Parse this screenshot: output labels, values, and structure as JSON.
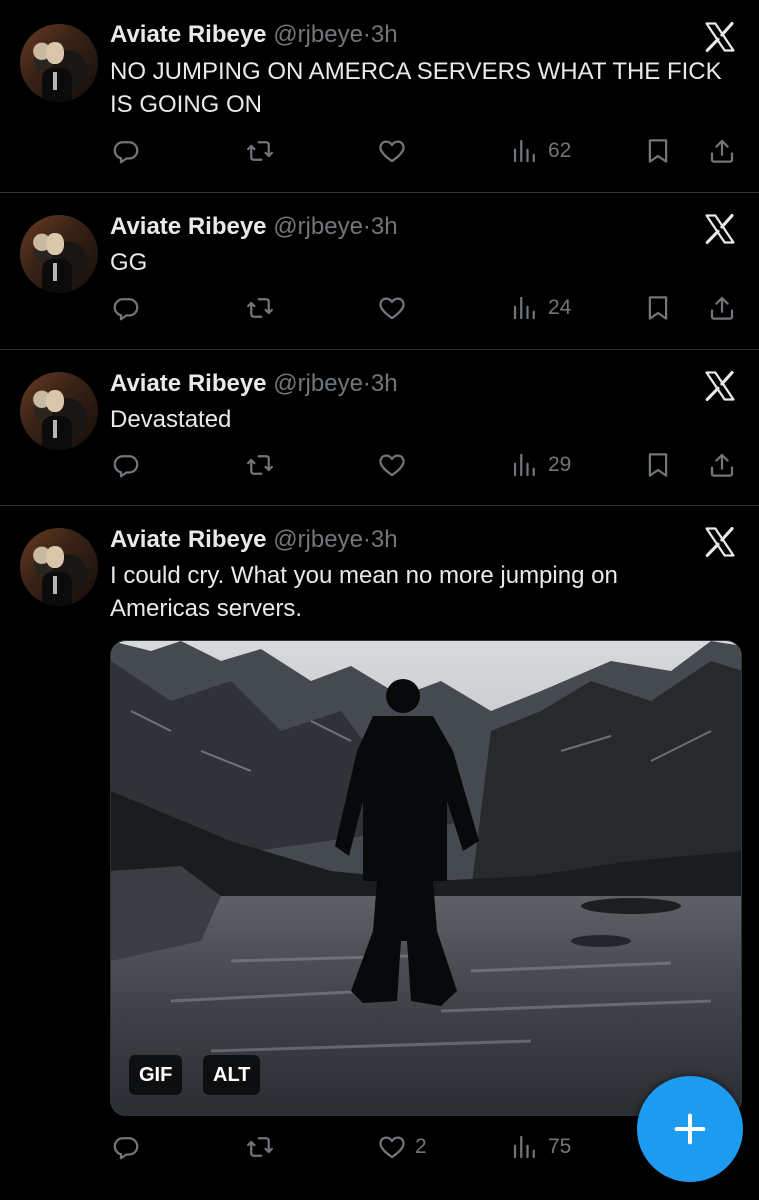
{
  "tweets": [
    {
      "name": "Aviate Ribeye",
      "handle": "@rjbeye",
      "separator": "·",
      "time": "3h",
      "text": "NO JUMPING ON AMERCA SERVERS WHAT THE FICK IS GOING ON",
      "likes": "",
      "views": "62"
    },
    {
      "name": "Aviate Ribeye",
      "handle": "@rjbeye",
      "separator": "·",
      "time": "3h",
      "text": "GG",
      "likes": "",
      "views": "24"
    },
    {
      "name": "Aviate Ribeye",
      "handle": "@rjbeye",
      "separator": "·",
      "time": "3h",
      "text": "Devastated",
      "likes": "",
      "views": "29"
    },
    {
      "name": "Aviate Ribeye",
      "handle": "@rjbeye",
      "separator": "·",
      "time": "3h",
      "text": "I could cry. What you mean no more jumping on Americas servers.",
      "likes": "2",
      "views": "75",
      "media": {
        "gif_badge": "GIF",
        "alt_badge": "ALT"
      }
    }
  ],
  "icons": {
    "reply": "reply-icon",
    "retweet": "retweet-icon",
    "like": "heart-icon",
    "views": "views-icon",
    "bookmark": "bookmark-icon",
    "share": "share-icon",
    "platform": "x-logo-icon",
    "compose": "plus-icon"
  },
  "colors": {
    "background": "#000000",
    "text": "#e7e9ea",
    "muted": "#71767b",
    "accent": "#1d9bf0",
    "divider": "#2f3336"
  }
}
